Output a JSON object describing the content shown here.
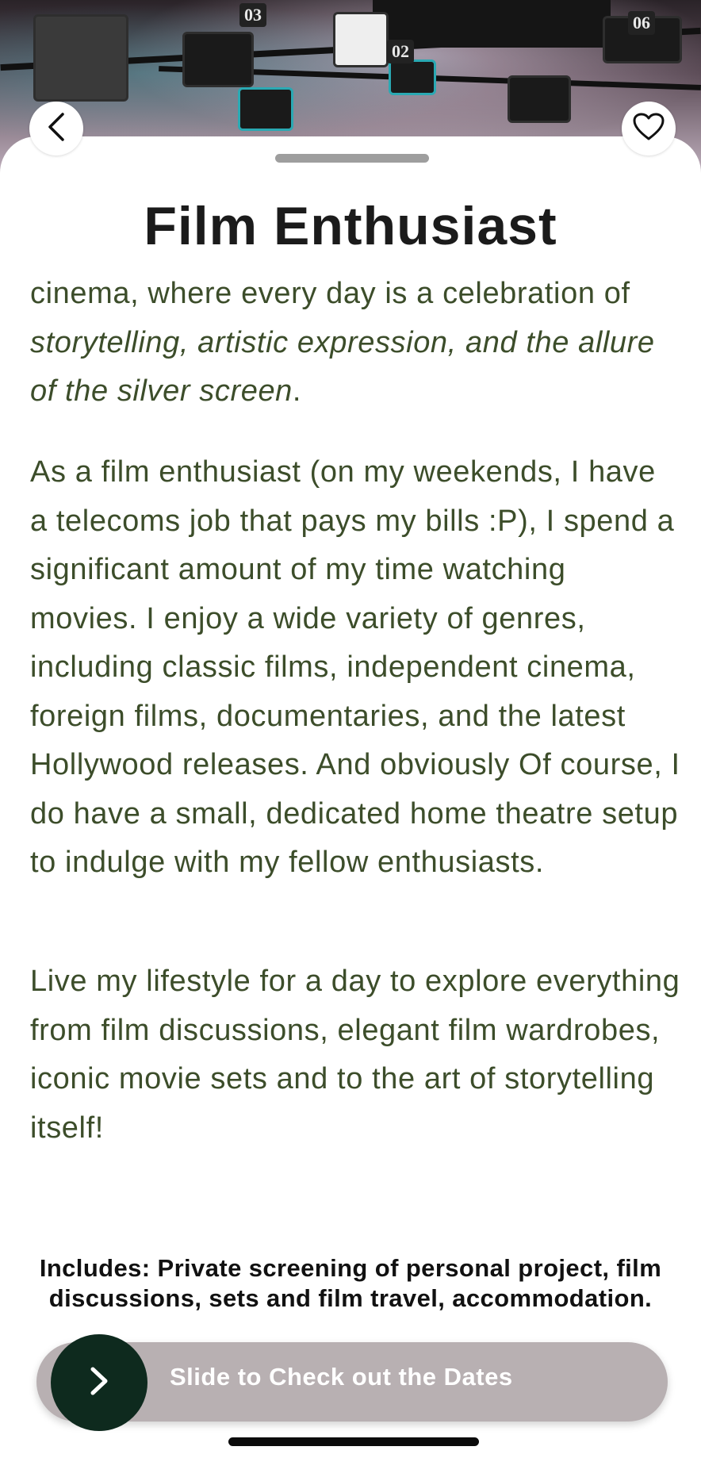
{
  "header": {
    "back_icon": "chevron-left-icon",
    "favorite_icon": "heart-outline-icon",
    "hero_labels": [
      "03",
      "02",
      "06"
    ]
  },
  "experience": {
    "title": "Film Enthusiast",
    "paragraph_1": {
      "plain": "cinema, where every day is a celebration of ",
      "italic": "storytelling, artistic expression, and the allure of the silver screen",
      "end": "."
    },
    "paragraph_2": "As a film enthusiast (on my weekends, I have a telecoms job that pays my bills :P), I spend a significant amount of my time watching movies. I enjoy a wide variety of genres, including classic films, independent cinema, foreign films, documentaries, and the latest Hollywood releases. And obviously Of course, I do have a small, dedicated home theatre setup to indulge with my fellow enthusiasts.",
    "paragraph_3": "Live my lifestyle for a day to explore everything from film discussions, elegant film wardrobes, iconic movie sets and to the art of storytelling itself!",
    "includes": "Includes: Private screening of personal project, film discussions, sets and film travel, accommodation."
  },
  "cta": {
    "slider_label": "Slide to Check out the Dates",
    "knob_icon": "chevron-right-icon"
  },
  "colors": {
    "body_text": "#3c4d2a",
    "slider_track": "#b8b0b2",
    "slider_knob": "#0e2a1e"
  }
}
